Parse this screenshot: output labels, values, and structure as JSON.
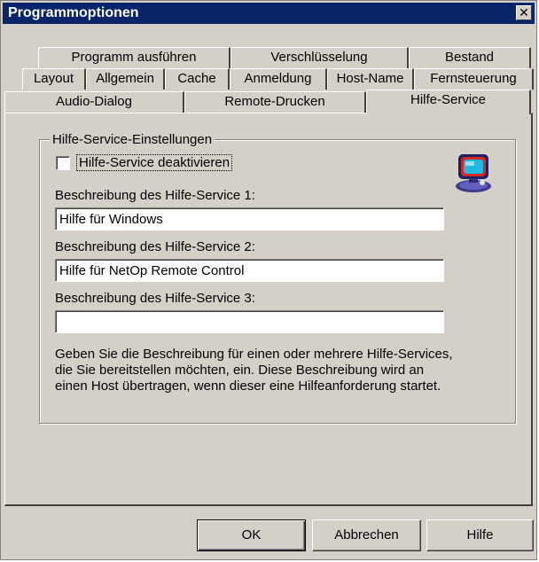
{
  "window": {
    "title": "Programmoptionen",
    "close_symbol": "✕"
  },
  "tabs": {
    "row1": [
      "Programm ausführen",
      "Verschlüsselung",
      "Bestand"
    ],
    "row2": [
      "Layout",
      "Allgemein",
      "Cache",
      "Anmeldung",
      "Host-Name",
      "Fernsteuerung"
    ],
    "row3": [
      "Audio-Dialog",
      "Remote-Drucken",
      "Hilfe-Service"
    ],
    "active": "Hilfe-Service"
  },
  "group": {
    "title": "Hilfe-Service-Einstellungen",
    "checkbox_label": "Hilfe-Service deaktivieren",
    "checkbox_checked": false,
    "icon": "helper-computer-icon",
    "field1_label": "Beschreibung des Hilfe-Service 1:",
    "field1_value": "Hilfe für Windows",
    "field2_label": "Beschreibung des Hilfe-Service 2:",
    "field2_value": "Hilfe für NetOp Remote Control",
    "field3_label": "Beschreibung des Hilfe-Service 3:",
    "field3_value": "",
    "description": [
      "Geben Sie die Beschreibung für einen oder mehrere Hilfe-Services,",
      "die Sie bereitstellen möchten, ein. Diese Beschreibung wird an",
      "einen Host übertragen, wenn dieser eine Hilfeanforderung startet."
    ]
  },
  "buttons": {
    "ok": "OK",
    "cancel": "Abbrechen",
    "help": "Hilfe"
  }
}
